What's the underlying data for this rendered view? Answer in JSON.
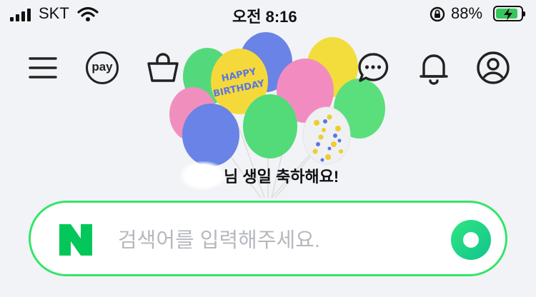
{
  "status_bar": {
    "carrier": "SKT",
    "time": "오전 8:16",
    "battery": "88%",
    "battery_level": 0.88,
    "icons": [
      "signal-icon",
      "wifi-icon",
      "rotation-lock-icon",
      "battery-charging-icon"
    ]
  },
  "header": {
    "pay_label": "pay",
    "icons": [
      "menu-icon",
      "pay-icon",
      "shopping-bag-icon",
      "balloons-doodle",
      "talk-icon",
      "bell-icon",
      "profile-icon"
    ]
  },
  "doodle": {
    "balloon_text_1": "HAPPY",
    "balloon_text_2": "BIRTHDAY",
    "greeting": "님 생일 축하해요!"
  },
  "search": {
    "placeholder": "검색어를 입력해주세요.",
    "value": "",
    "accent": "#35e46a",
    "logo_icon": "naver-n-icon",
    "button_icon": "green-search-icon"
  },
  "colors": {
    "background": "#f2f3f6",
    "brand_green": "#03c75a",
    "border_green": "#35e46a"
  }
}
